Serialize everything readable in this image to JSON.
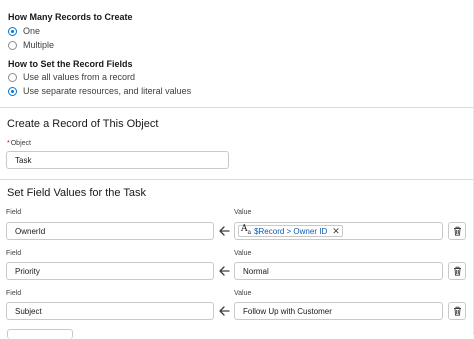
{
  "how_many": {
    "title": "How Many Records to Create",
    "options": [
      {
        "label": "One",
        "selected": true
      },
      {
        "label": "Multiple",
        "selected": false
      }
    ]
  },
  "how_to_set": {
    "title": "How to Set the Record Fields",
    "options": [
      {
        "label": "Use all values from a record",
        "selected": false
      },
      {
        "label": "Use separate resources, and literal values",
        "selected": true
      }
    ]
  },
  "create_record": {
    "heading": "Create a Record of This Object",
    "object_label": "Object",
    "object_required": "*",
    "object_value": "Task"
  },
  "field_values": {
    "heading": "Set Field Values for the Task",
    "field_label": "Field",
    "value_label": "Value",
    "rows": [
      {
        "field": "OwnerId",
        "value": "$Record > Owner ID",
        "value_type": "resource-pill",
        "icon": "text-aa-icon"
      },
      {
        "field": "Priority",
        "value": "Normal",
        "value_type": "text"
      },
      {
        "field": "Subject",
        "value": "Follow Up with Customer",
        "value_type": "text"
      }
    ]
  },
  "colors": {
    "accent": "#0176d3",
    "link": "#0b5cab",
    "border": "#c9c9c9"
  }
}
